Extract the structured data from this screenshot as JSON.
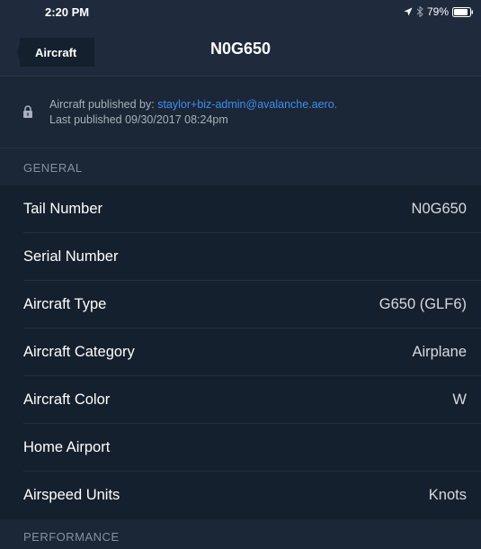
{
  "status_bar": {
    "time": "2:20 PM",
    "battery": "79%",
    "icons": [
      "location-arrow-icon",
      "bluetooth-icon",
      "battery-icon"
    ]
  },
  "nav": {
    "back_label": "Aircraft",
    "title": "N0G650"
  },
  "banner": {
    "line1_prefix": "Aircraft published by: ",
    "email": "staylor+biz-admin@avalanche.aero.",
    "line2": "Last published 09/30/2017 08:24pm"
  },
  "sections": {
    "general": "GENERAL",
    "performance": "PERFORMANCE"
  },
  "rows": [
    {
      "label": "Tail Number",
      "value": "N0G650"
    },
    {
      "label": "Serial Number",
      "value": ""
    },
    {
      "label": "Aircraft Type",
      "value": "G650 (GLF6)"
    },
    {
      "label": "Aircraft Category",
      "value": "Airplane"
    },
    {
      "label": "Aircraft Color",
      "value": "W"
    },
    {
      "label": "Home Airport",
      "value": ""
    },
    {
      "label": "Airspeed Units",
      "value": "Knots"
    }
  ],
  "colors": {
    "background": "#15202e",
    "nav_background": "#1f2b3c",
    "section_background": "#1b2636",
    "link_blue": "#3f8ef0",
    "secondary_text": "#a7b0bc"
  }
}
